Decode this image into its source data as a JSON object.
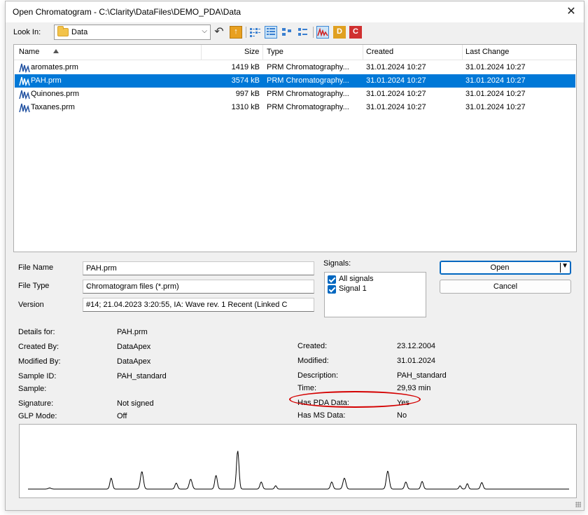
{
  "window": {
    "title": "Open Chromatogram - C:\\Clarity\\DataFiles\\DEMO_PDA\\Data"
  },
  "lookin": {
    "label": "Look In:",
    "value": "Data"
  },
  "toolbar": {
    "icons": [
      "back-icon",
      "up-folder-icon",
      "list-view-icon",
      "details-view-icon",
      "thumbnails-view-icon",
      "tiles-view-icon",
      "chromatogram-icon",
      "d-icon",
      "c-icon"
    ],
    "d_letter": "D",
    "c_letter": "C"
  },
  "filelist": {
    "columns": [
      "Name",
      "Size",
      "Type",
      "Created",
      "Last Change"
    ],
    "rows": [
      {
        "name": "aromates.prm",
        "size": "1419 kB",
        "type": "PRM Chromatography...",
        "created": "31.01.2024 10:27",
        "changed": "31.01.2024 10:27",
        "selected": false
      },
      {
        "name": "PAH.prm",
        "size": "3574 kB",
        "type": "PRM Chromatography...",
        "created": "31.01.2024 10:27",
        "changed": "31.01.2024 10:27",
        "selected": true
      },
      {
        "name": "Quinones.prm",
        "size": "997 kB",
        "type": "PRM Chromatography...",
        "created": "31.01.2024 10:27",
        "changed": "31.01.2024 10:27",
        "selected": false
      },
      {
        "name": "Taxanes.prm",
        "size": "1310 kB",
        "type": "PRM Chromatography...",
        "created": "31.01.2024 10:27",
        "changed": "31.01.2024 10:27",
        "selected": false
      }
    ]
  },
  "form": {
    "file_name_label": "File Name",
    "file_name_value": "PAH.prm",
    "file_type_label": "File Type",
    "file_type_value": "Chromatogram files (*.prm)",
    "version_label": "Version",
    "version_value": "#14;   21.04.2023   3:20:55,   IA: Wave rev. 1 Recent (Linked C"
  },
  "signals": {
    "label": "Signals:",
    "items": [
      {
        "label": "All signals",
        "checked": true
      },
      {
        "label": "Signal 1",
        "checked": true
      }
    ]
  },
  "buttons": {
    "open": "Open",
    "cancel": "Cancel"
  },
  "details": {
    "left": [
      {
        "label": "Details for:",
        "value": "PAH.prm"
      },
      {
        "label": "Created By:",
        "value": "DataApex"
      },
      {
        "label": "Modified By:",
        "value": "DataApex"
      },
      {
        "label": "Sample ID:",
        "value": "PAH_standard"
      },
      {
        "label": "Sample:",
        "value": ""
      },
      {
        "label": "Signature:",
        "value": "Not signed"
      },
      {
        "label": "GLP Mode:",
        "value": "Off"
      }
    ],
    "right": [
      {
        "label": "Created:",
        "value": "23.12.2004"
      },
      {
        "label": "Modified:",
        "value": "31.01.2024"
      },
      {
        "label": "Description:",
        "value": "PAH_standard"
      },
      {
        "label": "Time:",
        "value": "29,93 min"
      },
      {
        "label": "Has PDA Data:",
        "value": "Yes"
      },
      {
        "label": "Has MS Data:",
        "value": "No"
      }
    ]
  },
  "colors": {
    "selection": "#0078d7",
    "highlight_ellipse": "#d40000",
    "trace": "#000000"
  },
  "chart_data": {
    "type": "line",
    "title": "",
    "xlabel": "",
    "ylabel": "",
    "xlim": [
      0,
      29.93
    ],
    "ylim": [
      0,
      1
    ],
    "peaks": [
      {
        "rt": 1.2,
        "h": 0.02,
        "w": 0.08
      },
      {
        "rt": 4.6,
        "h": 0.2,
        "w": 0.07
      },
      {
        "rt": 6.3,
        "h": 0.32,
        "w": 0.08
      },
      {
        "rt": 8.2,
        "h": 0.11,
        "w": 0.07
      },
      {
        "rt": 9.0,
        "h": 0.18,
        "w": 0.08
      },
      {
        "rt": 10.4,
        "h": 0.25,
        "w": 0.07
      },
      {
        "rt": 11.6,
        "h": 0.7,
        "w": 0.07
      },
      {
        "rt": 12.9,
        "h": 0.13,
        "w": 0.07
      },
      {
        "rt": 13.7,
        "h": 0.06,
        "w": 0.06
      },
      {
        "rt": 16.8,
        "h": 0.13,
        "w": 0.07
      },
      {
        "rt": 17.5,
        "h": 0.2,
        "w": 0.08
      },
      {
        "rt": 19.9,
        "h": 0.33,
        "w": 0.08
      },
      {
        "rt": 20.9,
        "h": 0.13,
        "w": 0.07
      },
      {
        "rt": 21.8,
        "h": 0.14,
        "w": 0.07
      },
      {
        "rt": 23.9,
        "h": 0.06,
        "w": 0.06
      },
      {
        "rt": 24.3,
        "h": 0.1,
        "w": 0.06
      },
      {
        "rt": 25.1,
        "h": 0.12,
        "w": 0.07
      }
    ]
  }
}
